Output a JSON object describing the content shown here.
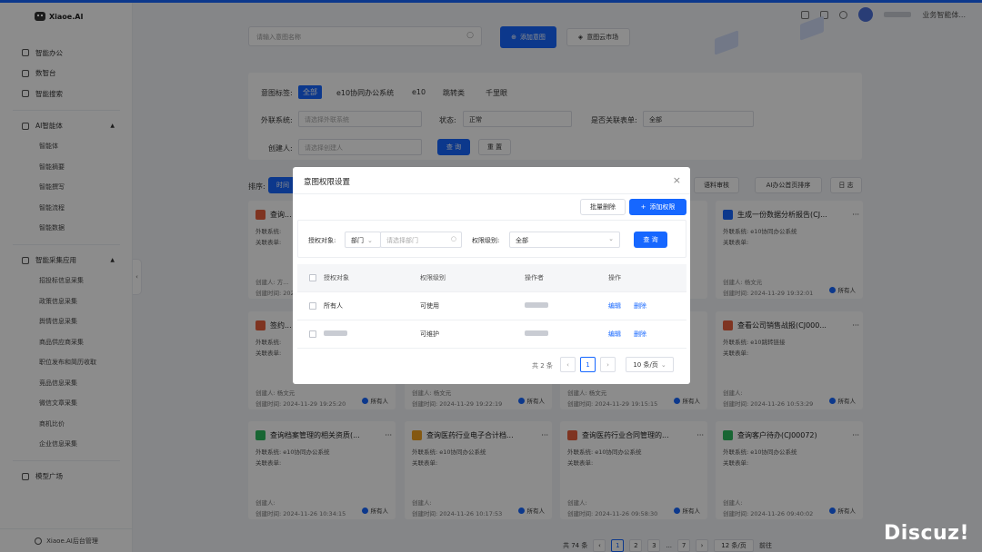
{
  "app": {
    "name": "Xiaoe.AI"
  },
  "header": {
    "user_label": "业务智能体..."
  },
  "sidebar": {
    "items": [
      {
        "label": "智能办公",
        "icon": "briefcase-icon"
      },
      {
        "label": "数智台",
        "icon": "grid-icon"
      },
      {
        "label": "智能搜索",
        "icon": "search-icon"
      },
      {
        "label": "AI智能体",
        "icon": "robot-icon",
        "expanded": true,
        "children": [
          "智能体",
          "智能摘要",
          "智能撰写",
          "智能流程",
          "智能数据"
        ]
      },
      {
        "label": "智能采集应用",
        "icon": "settings-icon",
        "expanded": true,
        "children": [
          "招投标信息采集",
          "政策信息采集",
          "舆情信息采集",
          "商品供应商采集",
          "职位发布和简历收取",
          "竞品信息采集",
          "微信文章采集",
          "商机比价",
          "企业信息采集"
        ]
      },
      {
        "label": "模型广场",
        "icon": "edit-icon"
      }
    ],
    "footer": "Xiaoe.AI后台管理"
  },
  "toolbar": {
    "search_placeholder": "请输入意图名称",
    "add_intent": "添加意图",
    "intent_market": "意图云市场"
  },
  "filters": {
    "tag_label": "意图标签:",
    "tags": [
      "全部",
      "e10协同办公系统",
      "e10",
      "跳转类",
      "千里眼"
    ],
    "ext_label": "外联系统:",
    "ext_placeholder": "请选择外联系统",
    "status_label": "状态:",
    "status_value": "正常",
    "related_label": "是否关联表单:",
    "related_value": "全部",
    "creator_label": "创建人:",
    "creator_placeholder": "请选择创建人",
    "query": "查 询",
    "reset": "重 置"
  },
  "sort": {
    "label": "排序:",
    "active": "时间",
    "buttons": [
      "语料审核",
      "AI办公首页排序",
      "日 志"
    ]
  },
  "cards": [
    {
      "title": "查询...",
      "ext": "外联系统:",
      "rel": "关联表单:",
      "creator": "创建人: 方...",
      "time": "创建时间: 2024-...",
      "badge": "",
      "color": "#e8603c"
    },
    {
      "title": "生成一份数据分析报告(CJ...",
      "ext": "外联系统: e10协同办公系统",
      "rel": "关联表单:",
      "creator": "创建人: 杨文元",
      "time": "创建时间: 2024-11-29 19:32:01",
      "badge": "所有人",
      "color": "#1667ff"
    },
    {
      "title": "签约...",
      "ext": "外联系统:",
      "rel": "关联表单:",
      "creator": "创建人: 杨文元",
      "time": "创建时间: 2024-11-29 19:25:20",
      "badge": "所有人",
      "color": "#e8603c"
    },
    {
      "title": "",
      "ext": "",
      "rel": "",
      "creator": "创建人: 杨文元",
      "time": "创建时间: 2024-11-29 19:22:19",
      "badge": "所有人",
      "color": "#e8603c"
    },
    {
      "title": "",
      "ext": "",
      "rel": "",
      "creator": "创建人: 杨文元",
      "time": "创建时间: 2024-11-29 19:15:15",
      "badge": "所有人",
      "color": "#e8603c"
    },
    {
      "title": "查看公司销售战报(CJ000...",
      "ext": "外联系统: e10跳转链接",
      "rel": "关联表单:",
      "creator": "创建人:",
      "time": "创建时间: 2024-11-26 10:53:29",
      "badge": "所有人",
      "color": "#e8603c"
    },
    {
      "title": "查询档案管理的相关资质(...",
      "ext": "外联系统: e10协同办公系统",
      "rel": "关联表单:",
      "creator": "创建人:",
      "time": "创建时间: 2024-11-26 10:34:15",
      "badge": "所有人",
      "color": "#2dbb5d"
    },
    {
      "title": "查询医药行业电子合计档...",
      "ext": "外联系统: e10协同办公系统",
      "rel": "关联表单:",
      "creator": "创建人:",
      "time": "创建时间: 2024-11-26 10:17:53",
      "badge": "所有人",
      "color": "#f0a020"
    },
    {
      "title": "查询医药行业合同管理的...",
      "ext": "外联系统: e10协同办公系统",
      "rel": "关联表单:",
      "creator": "创建人:",
      "time": "创建时间: 2024-11-26 09:58:30",
      "badge": "所有人",
      "color": "#e8603c"
    },
    {
      "title": "查询客户待办(CJ00072)",
      "ext": "外联系统: e10协同办公系统",
      "rel": "关联表单:",
      "creator": "创建人:",
      "time": "创建时间: 2024-11-26 09:40:02",
      "badge": "所有人",
      "color": "#2dbb5d"
    }
  ],
  "bottom_pager": {
    "total": "共 74 条",
    "pages": [
      "1",
      "2",
      "3",
      "...",
      "7"
    ],
    "size": "12 条/页",
    "jump": "前往"
  },
  "modal": {
    "title": "意图权限设置",
    "batch_delete": "批量删除",
    "add_permission": "添加权限",
    "auth_label": "授权对象:",
    "auth_type": "部门",
    "dept_placeholder": "请选择部门",
    "level_label": "权限级别:",
    "level_value": "全部",
    "query": "查 询",
    "columns": [
      "授权对象",
      "权限级别",
      "操作者",
      "操作"
    ],
    "rows": [
      {
        "object": "所有人",
        "level": "可使用",
        "edit": "编辑",
        "delete": "删除"
      },
      {
        "object": "",
        "level": "可维护",
        "edit": "编辑",
        "delete": "删除"
      }
    ],
    "pager": {
      "total": "共 2 条",
      "page": "1",
      "size": "10 条/页"
    }
  },
  "watermark": "Discuz!"
}
